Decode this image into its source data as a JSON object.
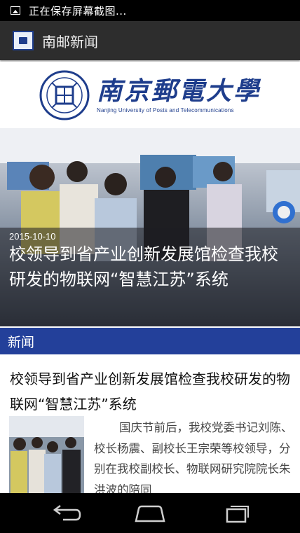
{
  "status_bar": {
    "notification_text": "正在保存屏幕截图..."
  },
  "action_bar": {
    "title": "南邮新闻"
  },
  "banner": {
    "title": "南京郵電大學",
    "subtitle": "Nanjing University of Posts and Telecommunications"
  },
  "hero": {
    "date": "2015-10-10",
    "title": "校领导到省产业创新发展馆检查我校研发的物联网“智慧江苏”系统"
  },
  "section": {
    "title": "新闻"
  },
  "article": {
    "title": "校领导到省产业创新发展馆检查我校研发的物联网“智慧江苏”系统",
    "body": "国庆节前后，我校党委书记刘陈、校长杨震、副校长王宗荣等校领导，分别在我校副校长、物联网研究院院长朱洪波的陪同"
  },
  "colors": {
    "accent": "#23409a",
    "action_bar": "#2d2d2d",
    "brand_blue": "#1e3d8c"
  },
  "icons": {
    "status": "image-icon",
    "app": "app-logo-icon",
    "nav": [
      "back-icon",
      "home-icon",
      "recent-apps-icon"
    ]
  }
}
